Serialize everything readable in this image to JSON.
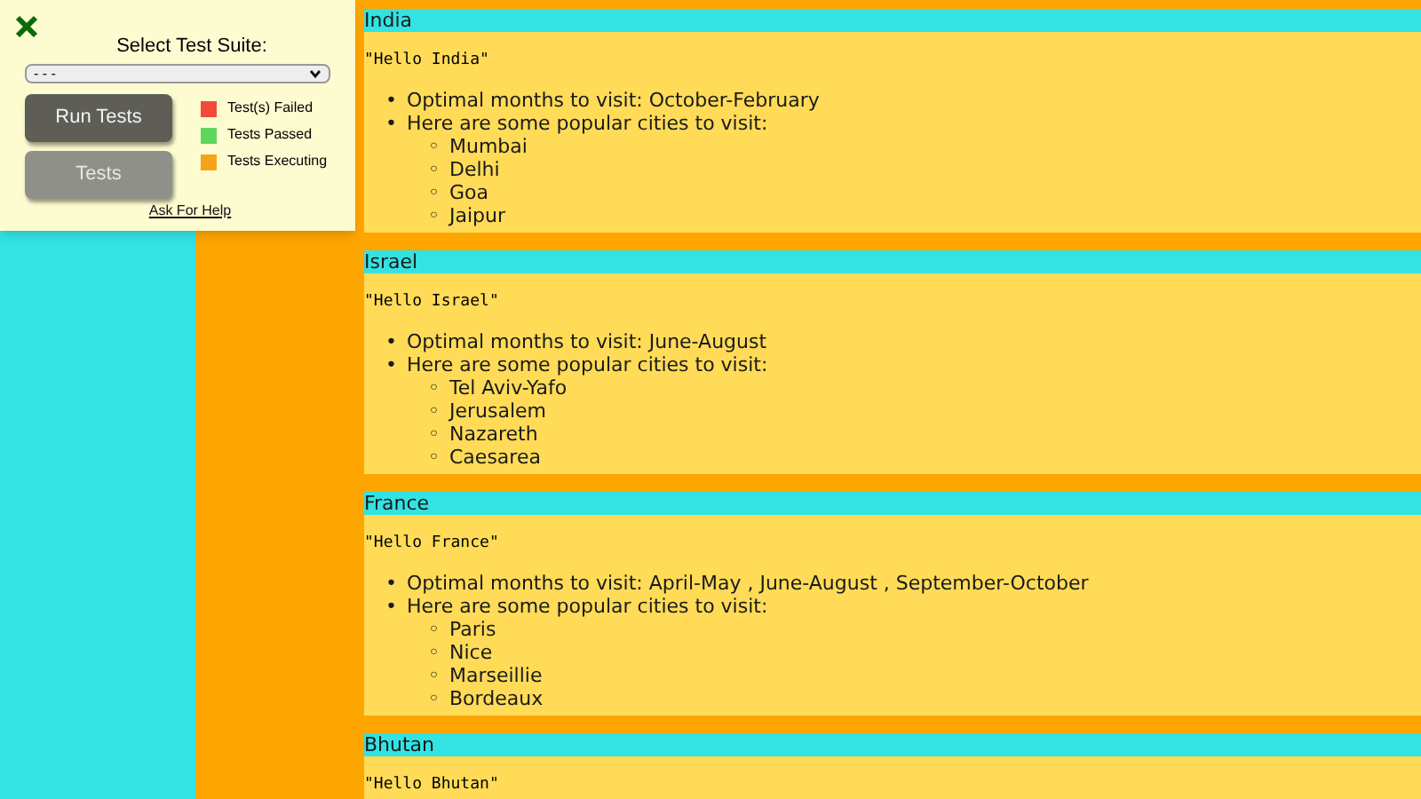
{
  "panel": {
    "title": "Select Test Suite:",
    "suite_select": {
      "value": "- - -"
    },
    "buttons": [
      {
        "label": "Run Tests",
        "disabled": false
      },
      {
        "label": "Tests",
        "disabled": true
      }
    ],
    "legend": [
      {
        "label": "Test(s) Failed",
        "color": "#f44a3c"
      },
      {
        "label": "Tests Passed",
        "color": "#5cd65c"
      },
      {
        "label": "Tests Executing",
        "color": "#f5a418"
      }
    ],
    "help_link": "Ask For Help"
  },
  "countries": [
    {
      "name": "India",
      "greeting": "\"Hello India\"",
      "facts": [
        {
          "marker": "•",
          "text": "Optimal months to visit: October-February"
        },
        {
          "marker": "•",
          "text": "Here are some popular cities to visit:",
          "children": [
            {
              "marker": "◦",
              "text": "Mumbai"
            },
            {
              "marker": "◦",
              "text": "Delhi"
            },
            {
              "marker": "◦",
              "text": "Goa"
            },
            {
              "marker": "◦",
              "text": "Jaipur"
            }
          ]
        }
      ]
    },
    {
      "name": "Israel",
      "greeting": "\"Hello Israel\"",
      "facts": [
        {
          "marker": "•",
          "text": "Optimal months to visit: June-August"
        },
        {
          "marker": "•",
          "text": "Here are some popular cities to visit:",
          "children": [
            {
              "marker": "◦",
              "text": "Tel Aviv-Yafo"
            },
            {
              "marker": "◦",
              "text": "Jerusalem"
            },
            {
              "marker": "◦",
              "text": "Nazareth"
            },
            {
              "marker": "◦",
              "text": "Caesarea"
            }
          ]
        }
      ]
    },
    {
      "name": "France",
      "greeting": "\"Hello France\"",
      "facts": [
        {
          "marker": "•",
          "text": "Optimal months to visit: April-May , June-August , September-October"
        },
        {
          "marker": "•",
          "text": "Here are some popular cities to visit:",
          "children": [
            {
              "marker": "◦",
              "text": "Paris"
            },
            {
              "marker": "◦",
              "text": "Nice"
            },
            {
              "marker": "◦",
              "text": "Marseillie"
            },
            {
              "marker": "◦",
              "text": "Bordeaux"
            }
          ]
        }
      ]
    },
    {
      "name": "Bhutan",
      "greeting": "\"Hello Bhutan\""
    }
  ]
}
